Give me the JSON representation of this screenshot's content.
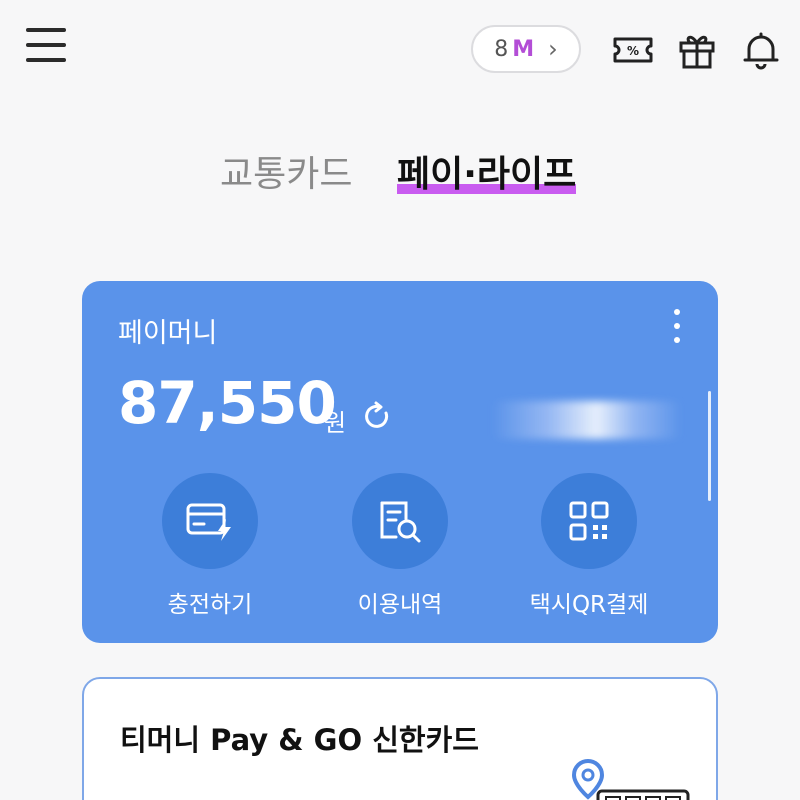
{
  "header": {
    "menu_icon": "hamburger-menu-icon",
    "mileage": {
      "value": "8",
      "unit": "M",
      "unit_color": "#b34dd6"
    },
    "icons": [
      "coupon-ticket-icon",
      "gift-icon",
      "notification-bell-icon"
    ]
  },
  "tabs": [
    {
      "label": "교통카드",
      "active": false
    },
    {
      "label": "페이·라이프",
      "active": true
    }
  ],
  "accent_colors": {
    "tab_highlight": "#c95cf0",
    "card_bg": "#5a93ea",
    "action_circle": "#3d7ed9"
  },
  "pay_card": {
    "title": "페이머니",
    "balance": "87,550",
    "currency": "원",
    "actions": [
      {
        "label": "충전하기",
        "icon": "charge-card-icon"
      },
      {
        "label": "이용내역",
        "icon": "history-search-icon"
      },
      {
        "label": "택시QR결제",
        "icon": "qr-code-icon"
      }
    ]
  },
  "promo": {
    "title": "티머니 Pay & GO 신한카드"
  }
}
